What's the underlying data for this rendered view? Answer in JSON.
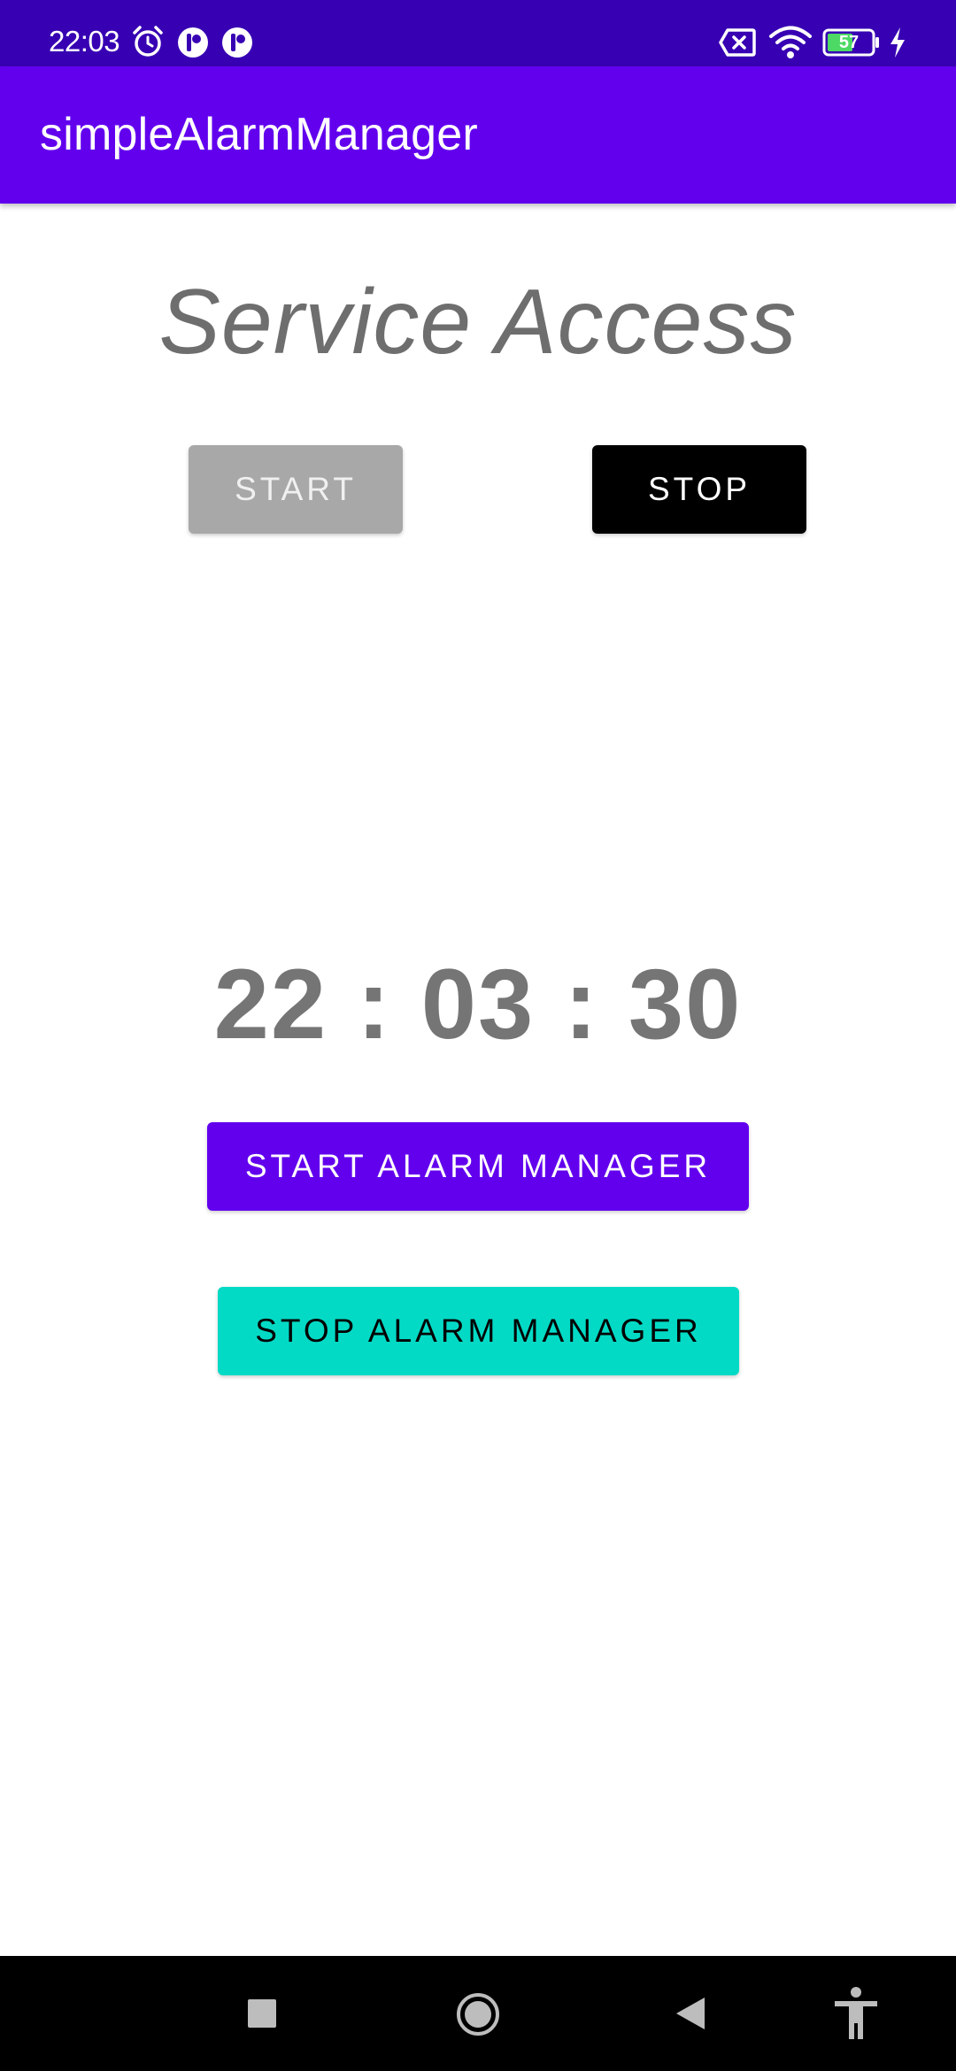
{
  "status_bar": {
    "time": "22:03",
    "battery_level": "57",
    "icons": [
      "alarm-icon",
      "notification-app-icon",
      "notification-app-icon",
      "sim-off-icon",
      "wifi-icon",
      "battery-icon",
      "charging-icon"
    ]
  },
  "app_bar": {
    "title": "simpleAlarmManager"
  },
  "main": {
    "service_title": "Service Access",
    "start_label": "START",
    "stop_label": "STOP",
    "clock": "22 : 03 : 30",
    "start_alarm_label": "START ALARM MANAGER",
    "stop_alarm_label": "STOP ALARM MANAGER"
  },
  "nav_bar": {
    "icons": [
      "recents-icon",
      "home-icon",
      "back-icon",
      "accessibility-icon"
    ]
  },
  "colors": {
    "status_bar": "#3700B3",
    "app_bar": "#6200EE",
    "start_disabled": "#A8A8A8",
    "stop": "#000000",
    "start_alarm": "#6200EE",
    "stop_alarm": "#03DAC5",
    "text_gray": "#757575"
  }
}
